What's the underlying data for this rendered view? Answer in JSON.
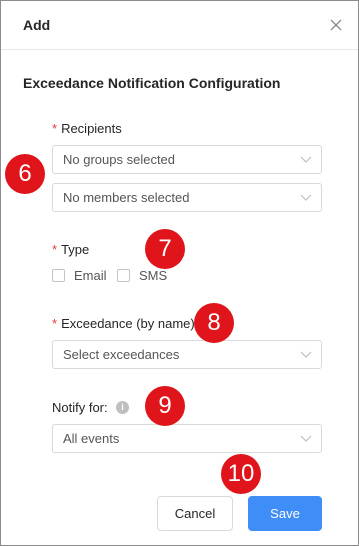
{
  "dialog": {
    "title": "Add",
    "close_icon": "close-icon"
  },
  "form": {
    "section_title": "Exceedance Notification Configuration",
    "required_mark": "*",
    "recipients": {
      "label": "Recipients",
      "groups_placeholder": "No groups selected",
      "members_placeholder": "No members selected"
    },
    "type": {
      "label": "Type",
      "options": [
        "Email",
        "SMS"
      ]
    },
    "exceedance": {
      "label": "Exceedance (by name)",
      "placeholder": "Select exceedances"
    },
    "notify_for": {
      "label": "Notify for:",
      "info_icon": "info-icon",
      "info_glyph": "i",
      "value": "All events"
    }
  },
  "buttons": {
    "cancel": "Cancel",
    "save": "Save"
  },
  "annotations": [
    "6",
    "7",
    "8",
    "9",
    "10"
  ],
  "colors": {
    "primary": "#3f8ef7",
    "required": "#e53935",
    "annotation_badge": "#e0141b"
  }
}
